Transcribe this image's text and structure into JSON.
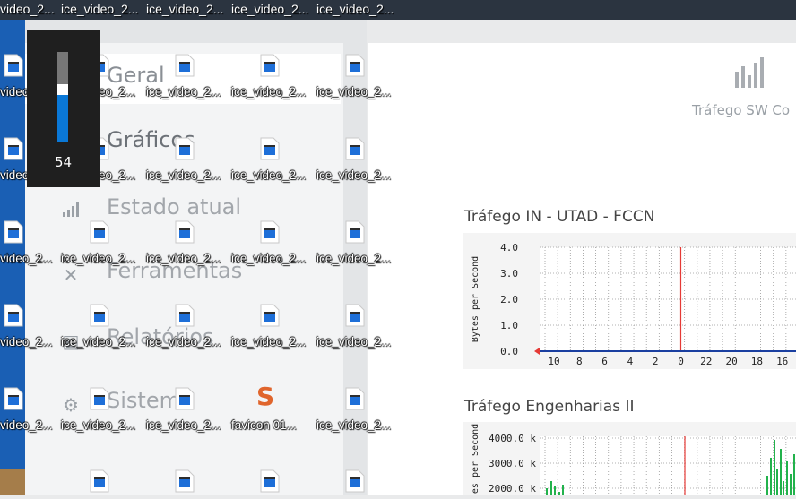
{
  "taskbar": {
    "items": [
      "video_2...",
      "ice_video_2...",
      "ice_video_2...",
      "ice_video_2...",
      "ice_video_2..."
    ]
  },
  "sidebar": {
    "items": [
      {
        "label": "Geral",
        "icon": "home-icon"
      },
      {
        "label": "Gráficos",
        "icon": "chart-icon"
      },
      {
        "label": "Estado atual",
        "icon": "bar-signal-icon"
      },
      {
        "label": "Ferramentas",
        "icon": "tools-icon"
      },
      {
        "label": "Relatórios",
        "icon": "report-icon"
      },
      {
        "label": "Sistema",
        "icon": "gear-icon"
      }
    ]
  },
  "header": {
    "title": "Tráfego SW Co"
  },
  "charts": [
    {
      "title": "Tráfego IN - UTAD - FCCN"
    },
    {
      "title": "Tráfego Engenharias II"
    }
  ],
  "chart_data": [
    {
      "type": "line",
      "title": "Tráfego IN - UTAD - FCCN",
      "ylabel": "Bytes per Second",
      "y_ticks": [
        "0.0",
        "1.0",
        "2.0",
        "3.0",
        "4.0"
      ],
      "ylim": [
        0,
        4
      ],
      "x_ticks": [
        "10",
        "8",
        "6",
        "4",
        "2",
        "0",
        "22",
        "20",
        "18",
        "16"
      ],
      "series": [
        {
          "values": [
            0,
            0,
            0,
            0,
            0,
            0,
            0,
            0,
            0,
            0
          ]
        }
      ],
      "grid": true,
      "marker_at": "0"
    },
    {
      "type": "area",
      "title": "Tráfego Engenharias II",
      "ylabel": "Bytes per Second",
      "y_ticks": [
        "2000.0 k",
        "3000.0 k",
        "4000.0 k"
      ],
      "grid": true
    }
  ],
  "desktop": {
    "label": "ice_video_2...",
    "left_label": "video_2...",
    "favicon_label": "favicon 01...",
    "favicon_glyph": "S"
  },
  "volume": {
    "value": "54",
    "level": 0.54
  },
  "colors": {
    "accent_blue": "#0a78d7",
    "chart_red": "#e53935",
    "chart_blue": "#1a3fa0",
    "chart_green": "#22b24c",
    "favicon_orange": "#e0652c"
  }
}
